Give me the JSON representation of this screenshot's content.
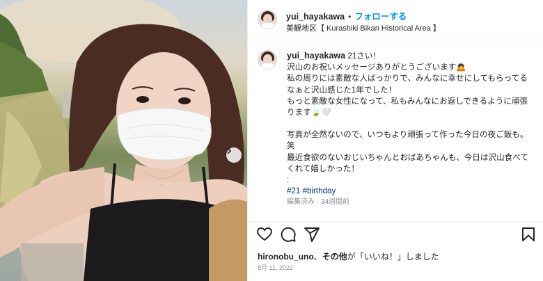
{
  "post": {
    "username": "yui_hayakawa",
    "separator": "•",
    "follow_label": "フォローする",
    "location": "美観地区【 Kurashiki Bikan Historical Area 】"
  },
  "caption": {
    "username": "yui_hayakawa",
    "first_line": "21さい！",
    "lines": [
      "沢山のお祝いメッセージありがとうございます🙇",
      "私の周りには素敵な人ばっかりで、みんなに幸せにしてもらってるなぁと沢山感じた1年でした！",
      "もっと素敵な女性になって、私もみんなにお返しできるように頑張ります🍃🤍",
      "",
      "写真が全然ないので、いつもより頑張って作った今日の夜ご飯も。笑",
      "最近食欲のないおじいちゃんとおばあちゃんも、今日は沢山食べてくれて嬉しかった！",
      ":"
    ],
    "hashtags": "#21 #birthday",
    "meta": "編集済み · 34週間前"
  },
  "likes": {
    "user": "hironobu_uno",
    "sep": "、",
    "others": "その他",
    "suffix": "が「いいね！」しました"
  },
  "date": "8月 11, 2022",
  "icons": [
    "heart-icon",
    "comment-icon",
    "share-icon",
    "bookmark-icon",
    "chevron-right-icon"
  ]
}
